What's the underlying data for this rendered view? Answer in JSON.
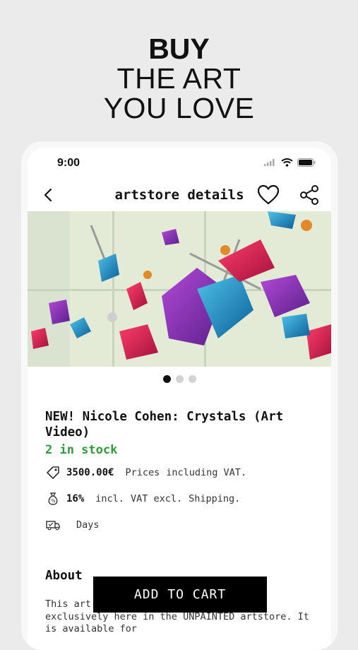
{
  "headline": {
    "line1": "BUY",
    "line2": "THE ART",
    "line3": "YOU LOVE"
  },
  "status_bar": {
    "time": "9:00",
    "icons": [
      "signal-icon",
      "wifi-icon",
      "battery-icon"
    ]
  },
  "navbar": {
    "title": "artstore details",
    "back_icon": "chevron-left-icon",
    "favorite_icon": "heart-icon",
    "share_icon": "share-icon"
  },
  "carousel": {
    "pages": 3,
    "active_page": 1
  },
  "product": {
    "title": "NEW! Nicole Cohen: Crystals (Art Video)",
    "stock": "2 in stock",
    "price": "3500.00€",
    "price_note_1": "Prices",
    "price_note_2": "including VAT.",
    "vat": "16%",
    "vat_note_1": "incl.",
    "vat_note_2": "VAT excl.",
    "vat_note_3": "Shipping.",
    "delivery": "Days"
  },
  "about": {
    "heading": "About",
    "text": "This art Nicole Cohen can be purchased exclusively here in the UNPAINTED artstore. It is available for"
  },
  "cart_button": {
    "label": "ADD TO CART"
  },
  "colors": {
    "stock_green": "#2f9a3a",
    "button_black": "#000000",
    "background": "#ebebeb"
  }
}
